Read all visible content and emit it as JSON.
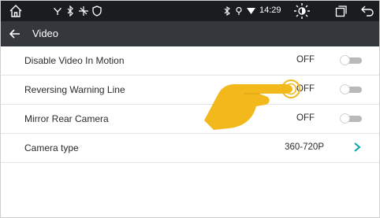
{
  "status_bar": {
    "icons": [
      "home-icon",
      "usb-icon",
      "bluetooth-icon",
      "location-icon",
      "wifi-icon",
      "brightness-icon",
      "recent-apps-icon",
      "back-arrow-icon"
    ],
    "time": "14:29"
  },
  "header": {
    "title": "Video"
  },
  "settings": [
    {
      "label": "Disable Video In Motion",
      "value": "OFF",
      "control": "toggle",
      "on": false
    },
    {
      "label": "Reversing Warning Line",
      "value": "OFF",
      "control": "toggle",
      "on": false
    },
    {
      "label": "Mirror Rear Camera",
      "value": "OFF",
      "control": "toggle",
      "on": false
    },
    {
      "label": "Camera type",
      "value": "360-720P",
      "control": "chevron"
    }
  ],
  "colors": {
    "status_bar_bg": "#1a1c1f",
    "title_bar_bg": "#34373c",
    "accent": "#0ca3a8",
    "hand": "#f2b81c"
  }
}
